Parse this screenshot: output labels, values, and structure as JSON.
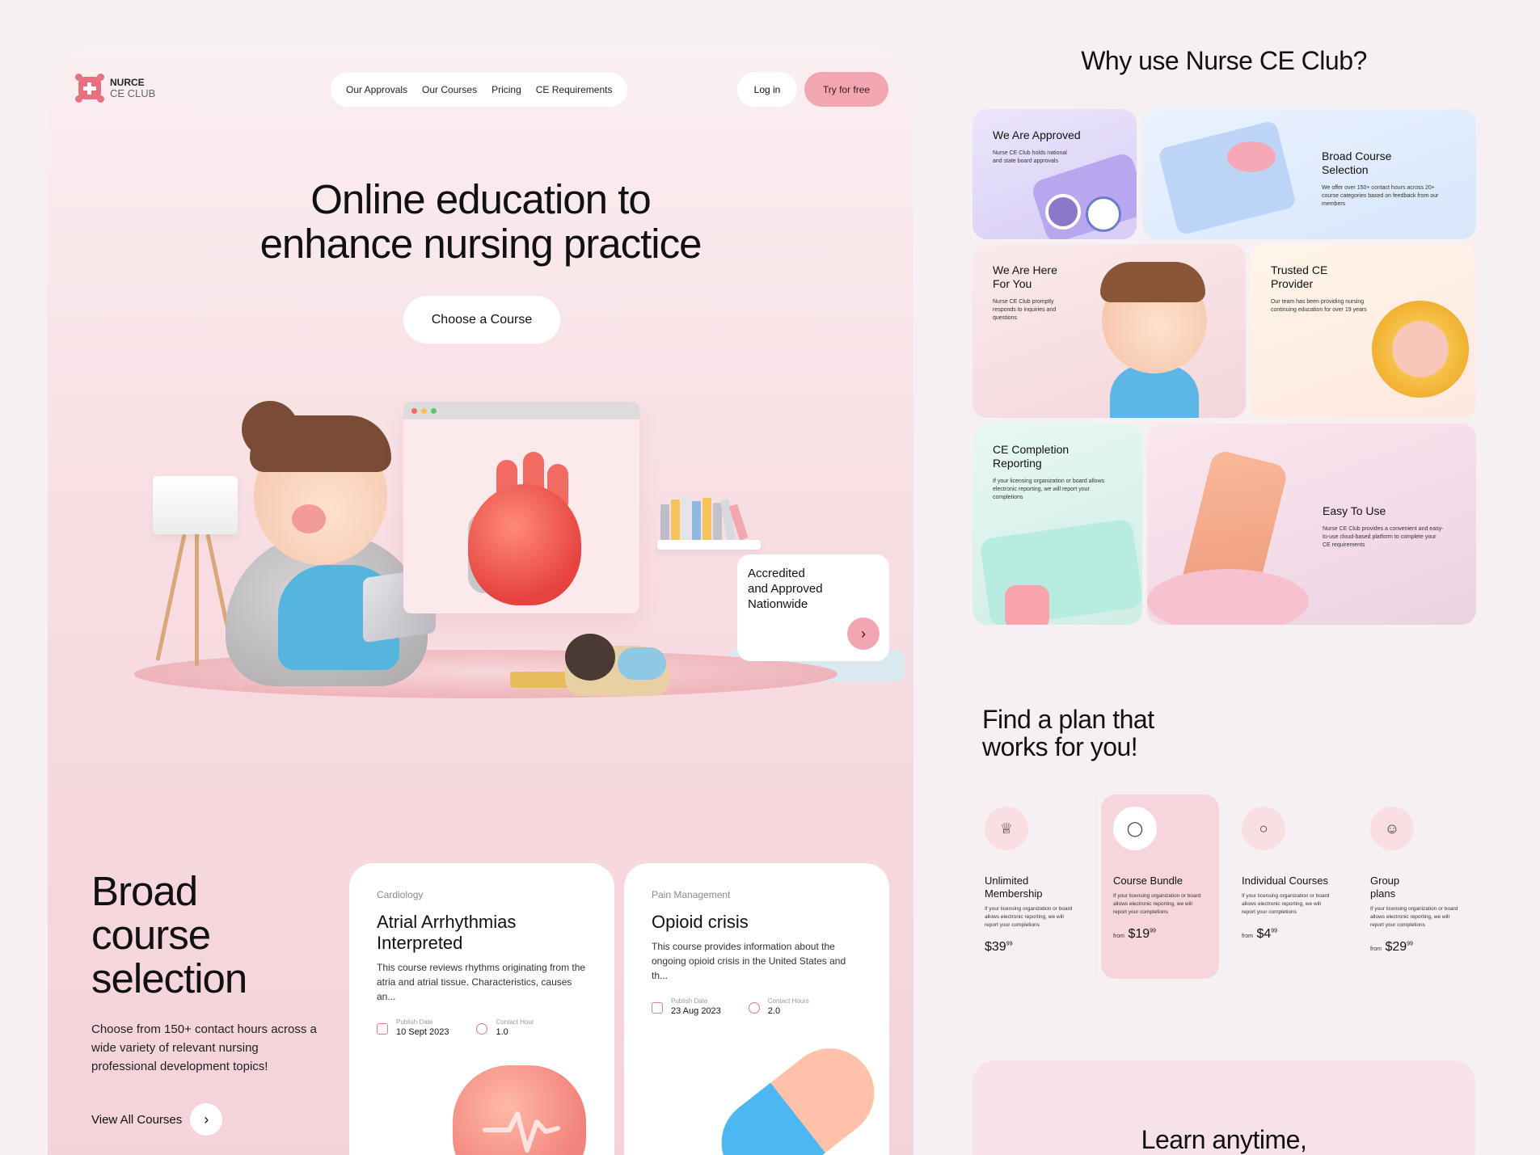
{
  "logo": {
    "line1": "NURCE",
    "line2": "CE CLUB"
  },
  "nav": {
    "items": [
      "Our Approvals",
      "Our Courses",
      "Pricing",
      "CE Requirements"
    ]
  },
  "header": {
    "login": "Log in",
    "try": "Try for free"
  },
  "hero": {
    "title_l1": "Online education to",
    "title_l2": "enhance nursing practice",
    "cta": "Choose a Course"
  },
  "accredited": {
    "text_l1": "Accredited",
    "text_l2": "and Approved",
    "text_l3": "Nationwide",
    "arrow_icon": "chevron-right"
  },
  "broad": {
    "title_l1": "Broad",
    "title_l2": "course",
    "title_l3": "selection",
    "desc": "Choose from 150+ contact hours across a wide variety of relevant nursing professional development topics!",
    "view_all": "View All Courses"
  },
  "courses": [
    {
      "category": "Cardiology",
      "title": "Atrial Arrhythmias Interpreted",
      "desc": "This course reviews rhythms originating from the atria and atrial tissue. Characteristics, causes an...",
      "date_label": "Publish Date",
      "date": "10 Sept 2023",
      "hours_label": "Contact Hour",
      "hours": "1.0"
    },
    {
      "category": "Pain Management",
      "title": "Opioid crisis",
      "desc": "This course provides information about the ongoing opioid crisis in the United States and th...",
      "date_label": "Publish Date",
      "date": "23 Aug 2023",
      "hours_label": "Contact Hours",
      "hours": "2.0"
    }
  ],
  "why": {
    "title": "Why use Nurse CE Club?",
    "cards": [
      {
        "title": "We Are Approved",
        "desc": "Nurse CE Club holds national and state board approvals"
      },
      {
        "title": "Broad Course Selection",
        "desc": "We offer over 150+ contact hours across 20+ course categories based on feedback from our members"
      },
      {
        "title": "We Are Here For You",
        "desc": "Nurse CE Club promptly responds to inquiries and questions"
      },
      {
        "title": "Trusted CE Provider",
        "desc": "Our team has been providing nursing continuing education for over 19 years"
      },
      {
        "title": "CE Completion Reporting",
        "desc": "If your licensing organization or board allows electronic reporting, we will report your completions"
      },
      {
        "title": "Easy To Use",
        "desc": "Nurse CE Club provides a convenient and easy-to-use cloud-based platform to complete your CE requirements"
      }
    ]
  },
  "plans": {
    "title_l1": "Find a plan that",
    "title_l2": "works for you!",
    "items": [
      {
        "title": "Unlimited Membership",
        "desc": "If your licensing organization or board allows electronic reporting, we will report your completions",
        "prefix": "",
        "price": "$39",
        "cents": "99",
        "icon": "crown-icon"
      },
      {
        "title": "Course Bundle",
        "desc": "If your licensing organization or board allows electronic reporting, we will report your completions",
        "prefix": "from",
        "price": "$19",
        "cents": "99",
        "icon": "bundle-icon"
      },
      {
        "title": "Individual Courses",
        "desc": "If your licensing organization or board allows electronic reporting, we will report your completions",
        "prefix": "from",
        "price": "$4",
        "cents": "99",
        "icon": "circle-icon"
      },
      {
        "title": "Group plans",
        "desc": "If your licensing organization or board allows electronic reporting, we will report your completions",
        "prefix": "from",
        "price": "$29",
        "cents": "99",
        "icon": "group-icon"
      }
    ]
  },
  "learn": {
    "title": "Learn anytime,"
  },
  "colors": {
    "accent": "#f2a6b2",
    "brand": "#e9707f",
    "panel": "#f7dde2"
  }
}
